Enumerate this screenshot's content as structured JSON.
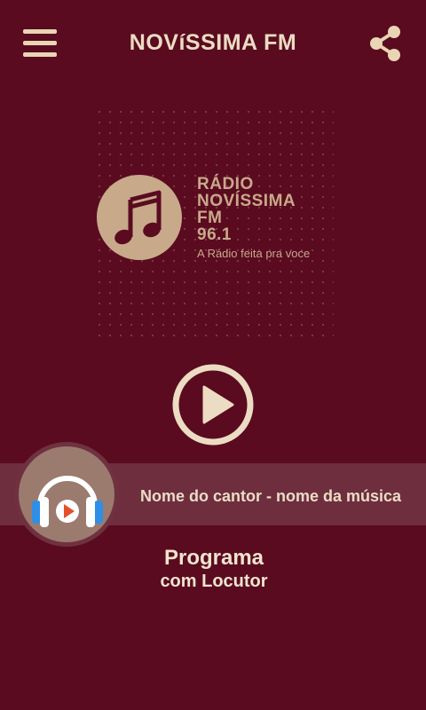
{
  "header": {
    "title": "NOVíSSIMA FM",
    "menu_icon": "hamburger-menu-icon",
    "share_icon": "share-icon"
  },
  "logo": {
    "line1": "RÁDIO",
    "line2": "NOVÍSSIMA",
    "line3": "FM",
    "line4": "96.1",
    "tagline": "A Rádio feita pra voce",
    "icon": "music-note-icon"
  },
  "player": {
    "play_icon": "play-icon",
    "now_playing": "Nome do cantor - nome da música",
    "headphones_icon": "headphones-play-icon"
  },
  "program": {
    "name": "Programa",
    "host": "com Locutor"
  },
  "colors": {
    "background": "#5a0b20",
    "accent": "#c8a98a",
    "text": "#f1e4cf",
    "bar": "#6e2e3e"
  }
}
